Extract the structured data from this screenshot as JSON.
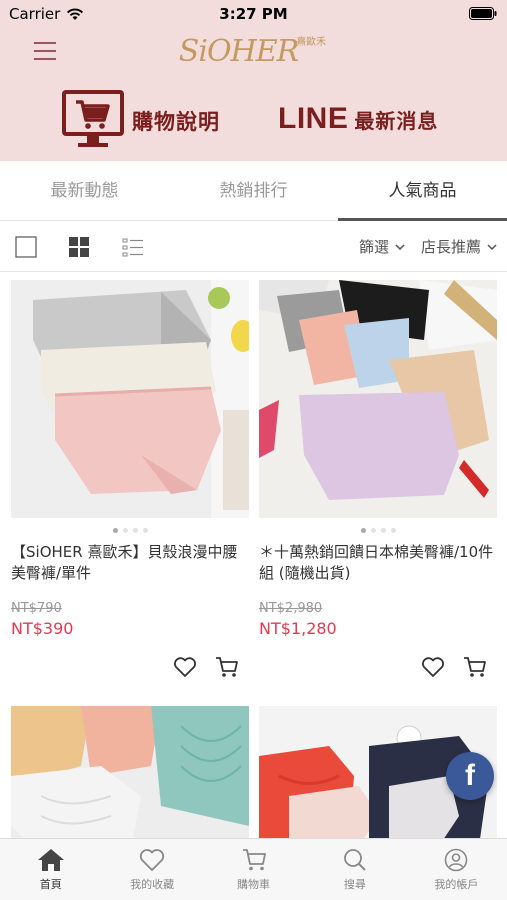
{
  "status_bar": {
    "carrier": "Carrier",
    "time": "3:27 PM"
  },
  "header": {
    "logo": "SiOHER",
    "logo_sub": "熹歐禾",
    "promo_shop": "購物說明",
    "promo_line_brand": "LINE",
    "promo_line_label": "最新消息"
  },
  "tabs": [
    {
      "label": "最新動態",
      "active": false
    },
    {
      "label": "熱銷排行",
      "active": false
    },
    {
      "label": "人氣商品",
      "active": true
    }
  ],
  "toolbar": {
    "filter": "篩選",
    "sort": "店長推薦"
  },
  "products": [
    {
      "title": "【SiOHER 熹歐禾】貝殼浪漫中腰美臀褲/單件",
      "price_orig": "NT$790",
      "price_sale": "NT$390"
    },
    {
      "title": "＊十萬熱銷回饋日本棉美臀褲/10件組 (隨機出貨)",
      "price_orig": "NT$2,980",
      "price_sale": "NT$1,280"
    }
  ],
  "floating": {
    "fb_label": "f"
  },
  "bottom_nav": [
    {
      "label": "首頁",
      "icon": "home-icon"
    },
    {
      "label": "我的收藏",
      "icon": "heart-icon"
    },
    {
      "label": "購物車",
      "icon": "cart-icon"
    },
    {
      "label": "搜尋",
      "icon": "search-icon"
    },
    {
      "label": "我的帳戶",
      "icon": "user-icon"
    }
  ],
  "colors": {
    "header_bg": "#f2dcdc",
    "brand_dark": "#7a1e1e",
    "logo_gold": "#c49a62",
    "sale_red": "#e8384f",
    "facebook": "#3b5998"
  }
}
